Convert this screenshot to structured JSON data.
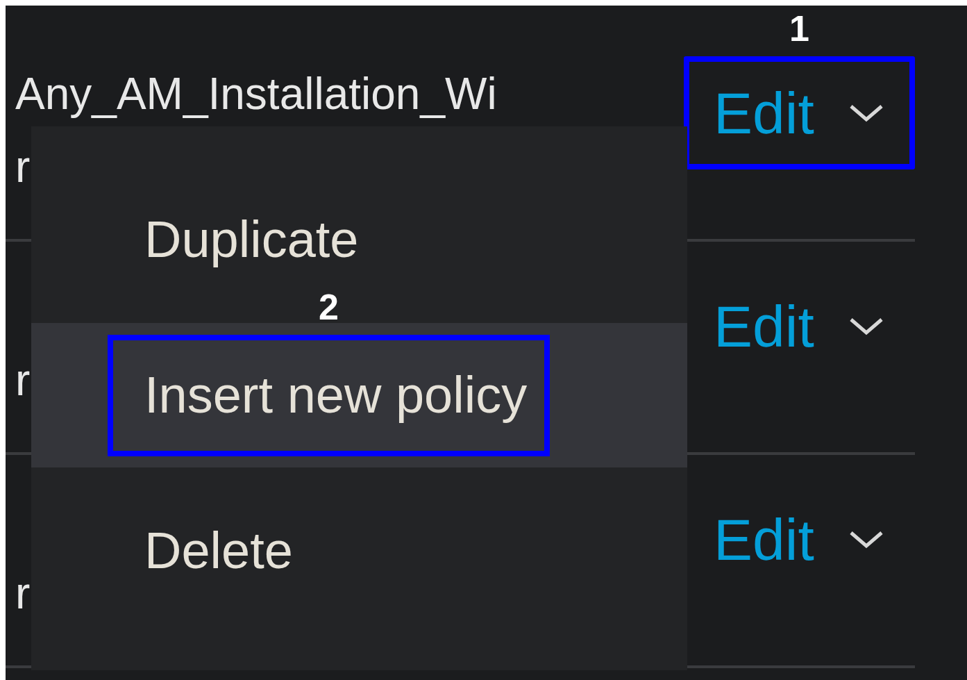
{
  "rows": [
    {
      "name_lines": [
        "Any_AM_Installation_Wi",
        "r"
      ],
      "action": "Edit",
      "annotation": "1"
    },
    {
      "name_lines": [
        "r"
      ],
      "action": "Edit"
    },
    {
      "name_lines": [
        "r"
      ],
      "action": "Edit"
    }
  ],
  "menu": {
    "items": [
      {
        "label": "Duplicate",
        "selected": false
      },
      {
        "label": "Insert new policy",
        "selected": true,
        "annotation": "2"
      },
      {
        "label": "Delete",
        "selected": false
      }
    ]
  }
}
